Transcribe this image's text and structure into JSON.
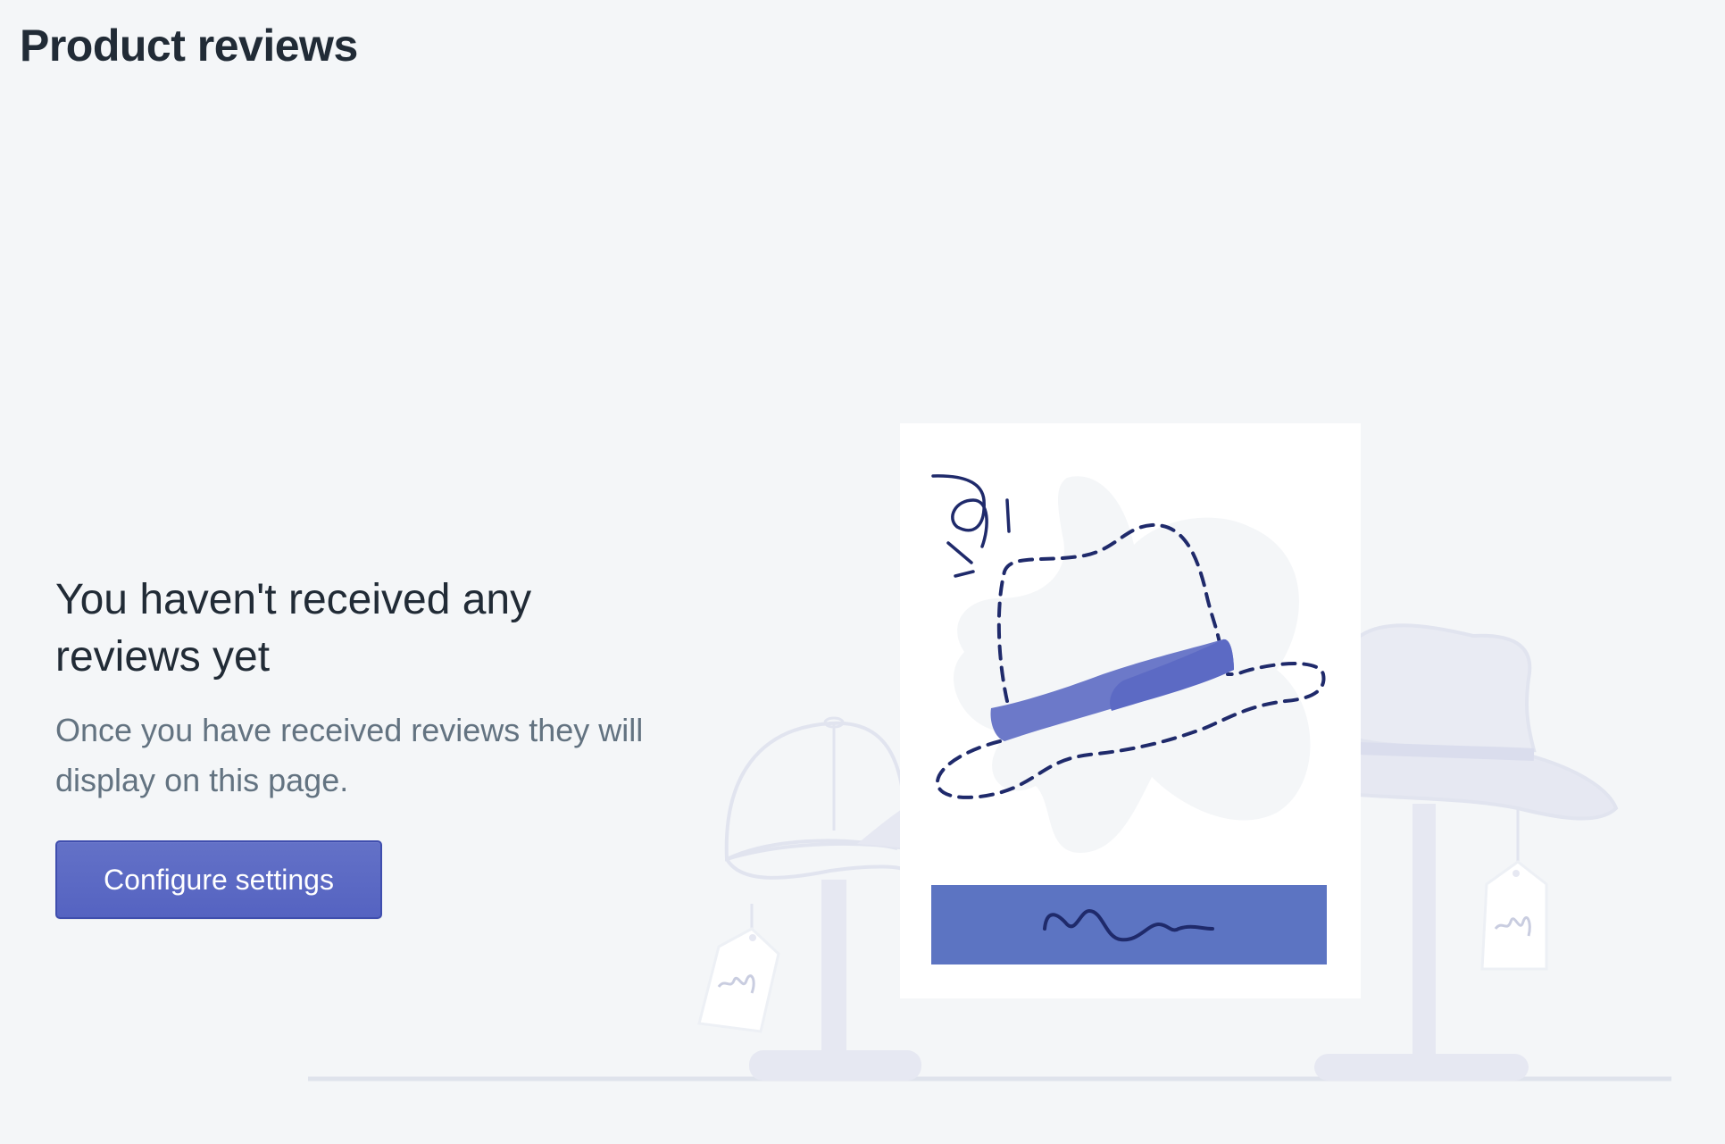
{
  "header": {
    "title": "Product reviews"
  },
  "empty_state": {
    "heading": "You haven't received any reviews yet",
    "description": "Once you have received reviews they will display on this page.",
    "action_label": "Configure settings"
  },
  "colors": {
    "background": "#f4f6f8",
    "primary_button": "#5c6ac4",
    "heading_text": "#212b36",
    "body_text": "#637381",
    "illustration_accent": "#5c6ac4",
    "illustration_line": "#1f2a6b"
  },
  "illustration": {
    "icon": "hat-display-illustration"
  }
}
